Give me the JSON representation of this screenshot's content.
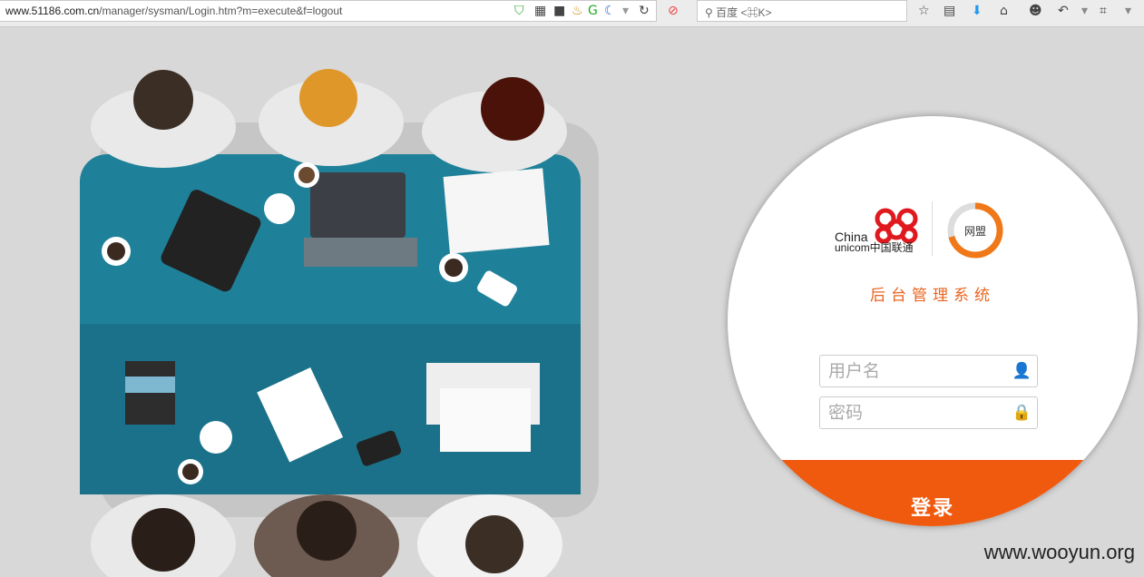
{
  "browser": {
    "url_host": "www.51186.com.cn",
    "url_path": "/manager/sysman/Login.htm?m=execute&f=logout",
    "search_placeholder": "百度 <⌘K>"
  },
  "login": {
    "brand_line1": "China",
    "brand_line2": "unicom中国联通",
    "partner_logo": "网盟",
    "system_title": "后台管理系统",
    "username_placeholder": "用户名",
    "password_placeholder": "密码",
    "submit_label": "登录"
  },
  "watermark": "www.wooyun.org",
  "colors": {
    "accent": "#f05a0e",
    "table": "#1f8199",
    "background": "#d8d8d8"
  }
}
